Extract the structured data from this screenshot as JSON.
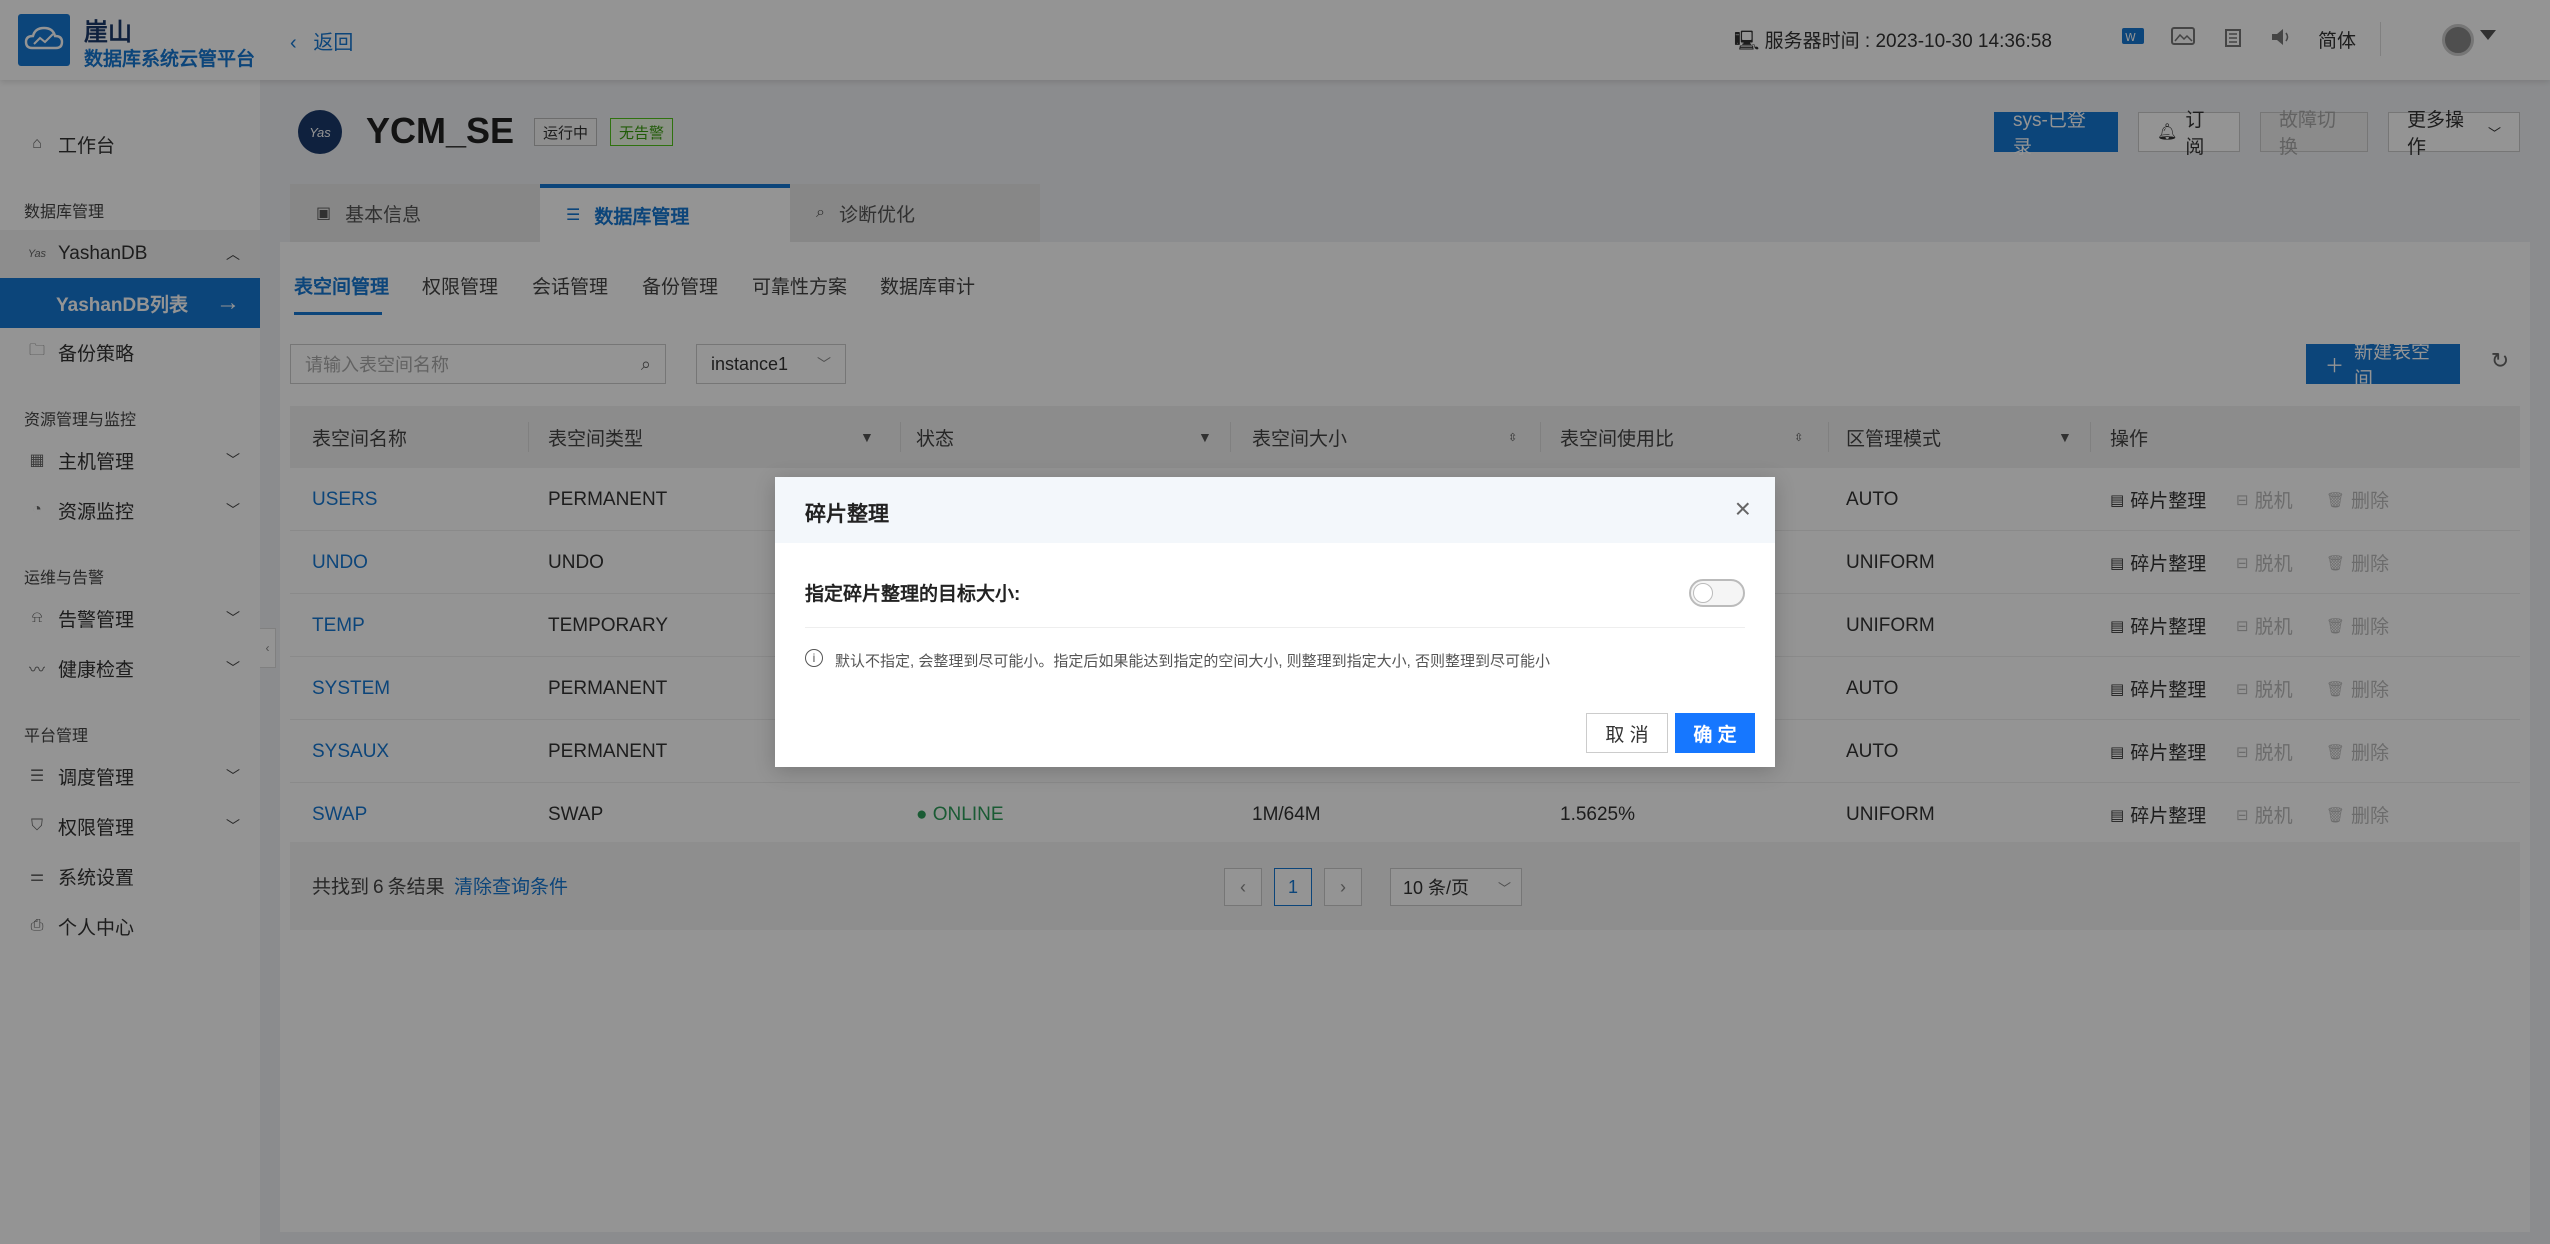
{
  "header": {
    "brand_name": "崖山",
    "brand_sub": "数据库系统云管平台",
    "back_label": "返回",
    "server_time": "服务器时间 : 2023-10-30 14:36:58",
    "lang": "简体"
  },
  "sidebar": {
    "workbench": "工作台",
    "group_db": "数据库管理",
    "yashandb": "YashanDB",
    "yashandb_list": "YashanDB列表",
    "backup_policy": "备份策略",
    "group_resource": "资源管理与监控",
    "host_mgmt": "主机管理",
    "resource_monitor": "资源监控",
    "group_ops": "运维与告警",
    "alarm_mgmt": "告警管理",
    "health_check": "健康检查",
    "group_platform": "平台管理",
    "schedule_mgmt": "调度管理",
    "perm_mgmt": "权限管理",
    "system_settings": "系统设置",
    "personal_center": "个人中心"
  },
  "db": {
    "logo_text": "Yas",
    "title": "YCM_SE",
    "tag_running": "运行中",
    "tag_noalarm": "无告警"
  },
  "actions": {
    "sys_login": "sys-已登录",
    "subscribe": "订阅",
    "failover": "故障切换",
    "more": "更多操作"
  },
  "top_tabs": [
    "基本信息",
    "数据库管理",
    "诊断优化"
  ],
  "sub_tabs": [
    "表空间管理",
    "权限管理",
    "会话管理",
    "备份管理",
    "可靠性方案",
    "数据库审计"
  ],
  "toolbar": {
    "search_placeholder": "请输入表空间名称",
    "instance": "instance1",
    "new_tablespace": "新建表空间"
  },
  "table": {
    "columns": [
      "表空间名称",
      "表空间类型",
      "状态",
      "表空间大小",
      "表空间使用比",
      "区管理模式",
      "操作"
    ],
    "rows": [
      {
        "name": "USERS",
        "type": "PERMANENT",
        "status": "",
        "size": "",
        "ratio": "",
        "mode": "AUTO"
      },
      {
        "name": "UNDO",
        "type": "UNDO",
        "status": "",
        "size": "",
        "ratio": "",
        "mode": "UNIFORM"
      },
      {
        "name": "TEMP",
        "type": "TEMPORARY",
        "status": "",
        "size": "",
        "ratio": "",
        "mode": "UNIFORM"
      },
      {
        "name": "SYSTEM",
        "type": "PERMANENT",
        "status": "",
        "size": "",
        "ratio": "",
        "mode": "AUTO"
      },
      {
        "name": "SYSAUX",
        "type": "PERMANENT",
        "status": "",
        "size": "",
        "ratio": "",
        "mode": "AUTO"
      },
      {
        "name": "SWAP",
        "type": "SWAP",
        "status": "● ONLINE",
        "size": "1M/64M",
        "ratio": "1.5625%",
        "mode": "UNIFORM"
      }
    ],
    "op_defrag": "碎片整理",
    "op_offline": "脱机",
    "op_delete": "删除"
  },
  "footer": {
    "found_prefix": "共找到",
    "found_count": "6",
    "found_suffix": "条结果",
    "clear": "清除查询条件",
    "page": "1",
    "page_size": "10 条/页"
  },
  "modal": {
    "title": "碎片整理",
    "label": "指定碎片整理的目标大小:",
    "note": "默认不指定, 会整理到尽可能小。指定后如果能达到指定的空间大小, 则整理到指定大小, 否则整理到尽可能小",
    "cancel": "取 消",
    "ok": "确 定",
    "toggle_on": false
  },
  "colors": {
    "primary": "#1677d2",
    "online": "#2e9d5b"
  }
}
